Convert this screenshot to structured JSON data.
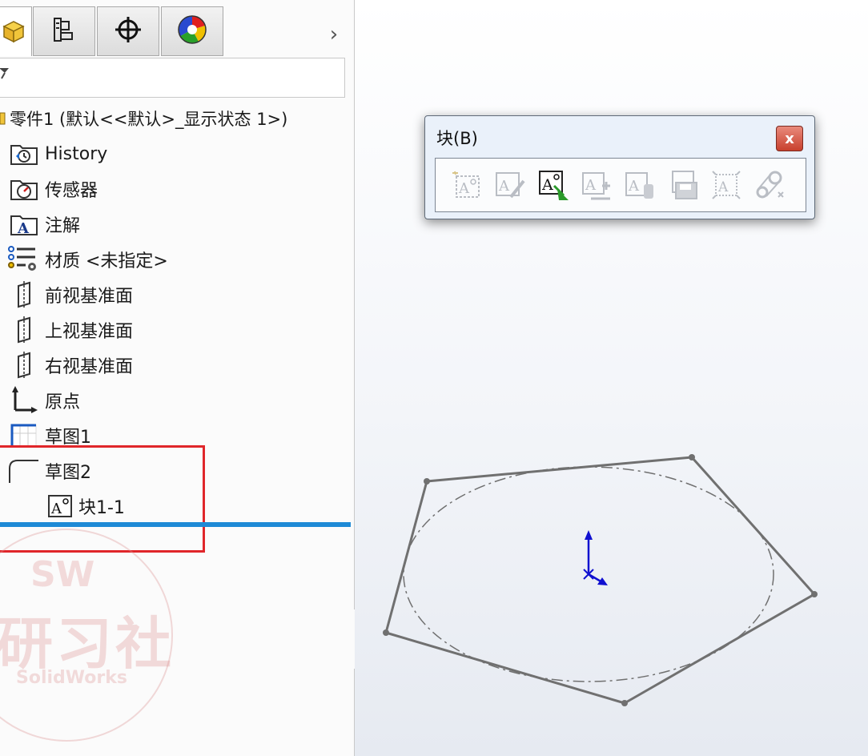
{
  "tabs": [
    {
      "name": "feature-manager",
      "icon": "part-cube-icon",
      "active": true
    },
    {
      "name": "property-manager",
      "icon": "property-manager-icon",
      "active": false
    },
    {
      "name": "configuration-manager",
      "icon": "crosshair-icon",
      "active": false
    },
    {
      "name": "display-manager",
      "icon": "color-wheel-icon",
      "active": false
    }
  ],
  "tabs_more_label": "›",
  "tree": {
    "root": "零件1  (默认<<默认>_显示状态 1>)",
    "items": [
      {
        "label": "History",
        "icon": "history-folder-icon"
      },
      {
        "label": "传感器",
        "icon": "sensor-folder-icon"
      },
      {
        "label": "注解",
        "icon": "annotation-folder-icon"
      },
      {
        "label": "材质 <未指定>",
        "icon": "material-icon"
      },
      {
        "label": "前视基准面",
        "icon": "plane-icon"
      },
      {
        "label": "上视基准面",
        "icon": "plane-icon"
      },
      {
        "label": "右视基准面",
        "icon": "plane-icon"
      },
      {
        "label": "原点",
        "icon": "origin-icon"
      },
      {
        "label": "草图1",
        "icon": "sketch-icon"
      },
      {
        "label": "草图2",
        "icon": "sketch-icon"
      },
      {
        "label": "块1-1",
        "icon": "block-icon"
      }
    ]
  },
  "watermark": {
    "top": "SW",
    "middle": "研习社",
    "bottom": "SolidWorks"
  },
  "block_toolbar": {
    "title": "块(B)",
    "close_label": "x",
    "buttons": [
      {
        "name": "make-block",
        "enabled": false
      },
      {
        "name": "edit-block",
        "enabled": false
      },
      {
        "name": "insert-block",
        "enabled": true
      },
      {
        "name": "add-remove-block",
        "enabled": false
      },
      {
        "name": "rebuild-block",
        "enabled": false
      },
      {
        "name": "save-block",
        "enabled": false
      },
      {
        "name": "explode-block",
        "enabled": false
      },
      {
        "name": "belt-chain",
        "enabled": false
      }
    ]
  },
  "colors": {
    "highlight": "#e0262a",
    "separator": "#1e8ad6",
    "sketch_line": "#707070",
    "axis": "#1010d0"
  }
}
